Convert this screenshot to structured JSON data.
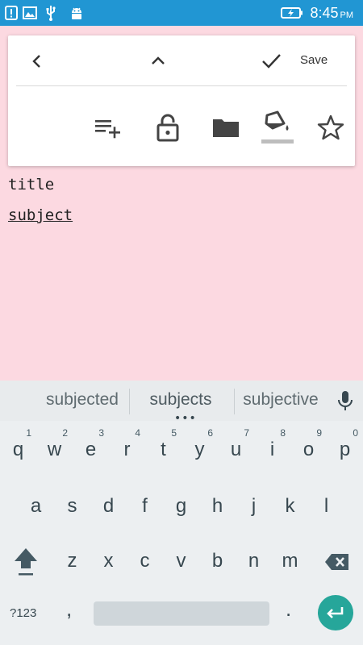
{
  "status_bar": {
    "time": "8:45",
    "ampm": "PM",
    "icons": [
      "alert-icon",
      "image-icon",
      "usb-icon",
      "android-icon",
      "battery-charging-icon"
    ]
  },
  "toolbar": {
    "save_label": "Save",
    "icons": [
      "back-arrow-icon",
      "collapse-chevron-icon",
      "checkmark-icon",
      "add-checklist-icon",
      "unlock-icon",
      "folder-icon",
      "paint-bucket-icon",
      "star-icon"
    ]
  },
  "note": {
    "title": "title",
    "subject": "subject"
  },
  "keyboard": {
    "suggestions": [
      "subjected",
      "subjects",
      "subjective"
    ],
    "row1": [
      {
        "ch": "q",
        "hint": "1"
      },
      {
        "ch": "w",
        "hint": "2"
      },
      {
        "ch": "e",
        "hint": "3"
      },
      {
        "ch": "r",
        "hint": "4"
      },
      {
        "ch": "t",
        "hint": "5"
      },
      {
        "ch": "y",
        "hint": "6"
      },
      {
        "ch": "u",
        "hint": "7"
      },
      {
        "ch": "i",
        "hint": "8"
      },
      {
        "ch": "o",
        "hint": "9"
      },
      {
        "ch": "p",
        "hint": "0"
      }
    ],
    "row2": [
      "a",
      "s",
      "d",
      "f",
      "g",
      "h",
      "j",
      "k",
      "l"
    ],
    "row3": [
      "z",
      "x",
      "c",
      "v",
      "b",
      "n",
      "m"
    ],
    "symbols_label": "?123",
    "comma": ",",
    "period": "."
  },
  "colors": {
    "status_bar": "#2196d3",
    "note_background": "#fcd9e1",
    "keyboard_background": "#eceff1",
    "enter_key": "#26a69a"
  }
}
